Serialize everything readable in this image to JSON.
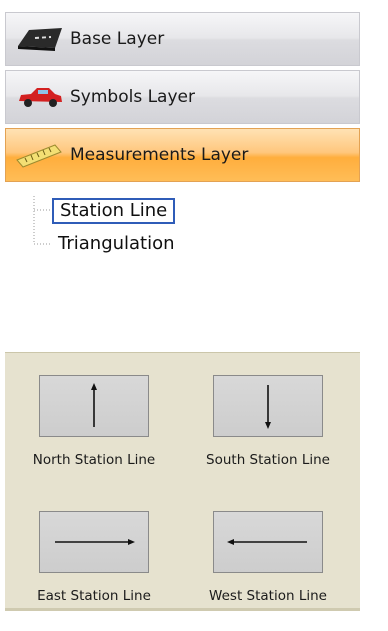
{
  "layers": [
    {
      "label": "Base Layer",
      "icon": "road-icon",
      "active": false
    },
    {
      "label": "Symbols Layer",
      "icon": "car-icon",
      "active": false
    },
    {
      "label": "Measurements Layer",
      "icon": "ruler-icon",
      "active": true
    }
  ],
  "tree": {
    "items": [
      {
        "label": "Station Line",
        "selected": true
      },
      {
        "label": "Triangulation",
        "selected": false
      }
    ]
  },
  "tools": [
    {
      "label": "North Station Line",
      "icon": "arrow-up-icon"
    },
    {
      "label": "South Station Line",
      "icon": "arrow-down-icon"
    },
    {
      "label": "East Station Line",
      "icon": "arrow-right-icon"
    },
    {
      "label": "West Station Line",
      "icon": "arrow-left-icon"
    }
  ],
  "colors": {
    "active_layer": "#ffbd57",
    "selection_border": "#2f5cb8",
    "tool_area_bg": "#e6e2cf"
  }
}
